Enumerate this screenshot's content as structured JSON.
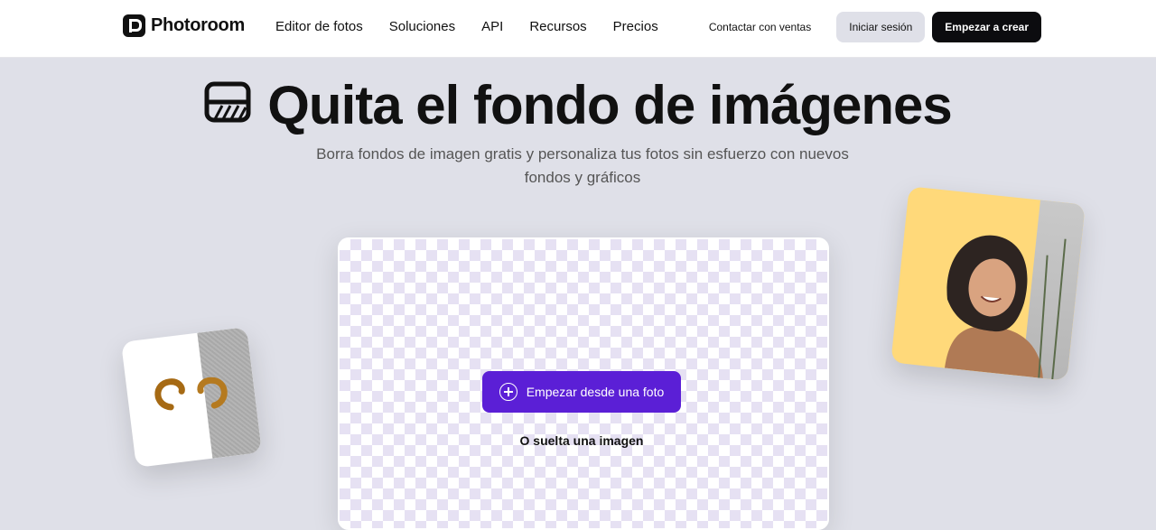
{
  "brand": {
    "name": "Photoroom"
  },
  "nav": {
    "items": [
      "Editor de fotos",
      "Soluciones",
      "API",
      "Recursos",
      "Precios"
    ],
    "contact": "Contactar con ventas",
    "login": "Iniciar sesión",
    "create": "Empezar a crear"
  },
  "hero": {
    "title": "Quita el fondo de imágenes",
    "subtitle": "Borra fondos de imagen gratis y personaliza tus fotos sin esfuerzo con nuevos fondos y gráficos"
  },
  "upload": {
    "button": "Empezar desde una foto",
    "drop": "O suelta una imagen"
  },
  "colors": {
    "accent": "#5b1fd6",
    "background": "#dfe0e8",
    "dark": "#0c0c0f"
  }
}
